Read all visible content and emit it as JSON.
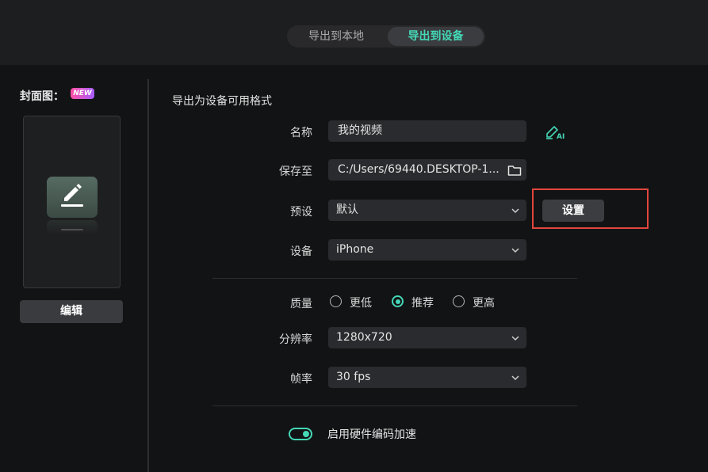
{
  "tabs": {
    "local": "导出到本地",
    "device": "导出到设备"
  },
  "cover": {
    "label": "封面图：",
    "badge": "NEW",
    "edit_label": "编辑"
  },
  "section_title": "导出为设备可用格式",
  "form": {
    "name": {
      "label": "名称",
      "value": "我的视频"
    },
    "save_to": {
      "label": "保存至",
      "value": "C:/Users/69440.DESKTOP-1..."
    },
    "preset": {
      "label": "预设",
      "value": "默认",
      "settings_label": "设置"
    },
    "device": {
      "label": "设备",
      "value": "iPhone"
    },
    "quality": {
      "label": "质量",
      "options": [
        "更低",
        "推荐",
        "更高"
      ],
      "selected": "推荐"
    },
    "resolution": {
      "label": "分辨率",
      "value": "1280x720"
    },
    "framerate": {
      "label": "帧率",
      "value": "30 fps"
    },
    "hw_accel": {
      "label": "启用硬件编码加速",
      "enabled": true
    }
  },
  "colors": {
    "accent": "#44d7b6",
    "highlight": "#e2463e",
    "background": "#121314"
  },
  "icons": {
    "ai": "ai-pen-icon",
    "folder": "folder-icon",
    "chevron": "chevron-down-icon",
    "cover": "pencil-edit-icon"
  }
}
